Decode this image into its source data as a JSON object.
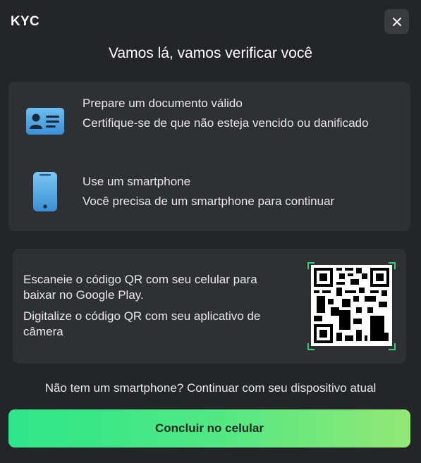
{
  "header": {
    "title": "KYC"
  },
  "heading": "Vamos lá, vamos verificar você",
  "steps": [
    {
      "icon": "id-card-icon",
      "title": "Prepare um documento válido",
      "description": "Certifique-se de que não esteja vencido ou danificado"
    },
    {
      "icon": "smartphone-icon",
      "title": "Use um smartphone",
      "description": "Você precisa de um smartphone para continuar"
    }
  ],
  "qr_section": {
    "text_1": "Escaneie o código QR com seu celular para baixar no Google Play.",
    "text_2": "Digitalize o código QR com seu aplicativo de câmera"
  },
  "alt_link": "Não tem um smartphone? Continuar com seu dispositivo atual",
  "cta": {
    "label": "Concluir no celular"
  },
  "colors": {
    "background": "#242528",
    "card": "#2f3034",
    "accent_start": "#2ee68a",
    "accent_end": "#93e875",
    "icon_blue": "#4aa8e8"
  }
}
